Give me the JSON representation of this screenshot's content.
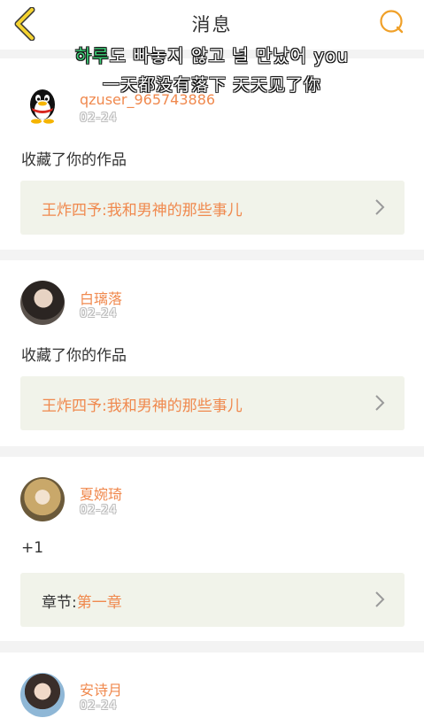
{
  "header": {
    "title": "消息",
    "colors": {
      "accent": "#f0a028",
      "back_fill": "#f5d330"
    }
  },
  "overlay": {
    "line1_accent": "하루",
    "line1_rest": "도 빠놓지 않고 널 만났어 you",
    "line2": "一天都没有落下 天天见了你"
  },
  "messages": [
    {
      "user": "qzuser_965743886",
      "date": "02-24",
      "action": "收藏了你的作品",
      "work_prefix": "",
      "work_title": "王炸四予:我和男神的那些事儿",
      "avatar": "qq-penguin-avatar"
    },
    {
      "user": "白璃落",
      "date": "02-24",
      "action": "收藏了你的作品",
      "work_prefix": "",
      "work_title": "王炸四予:我和男神的那些事儿",
      "avatar": "girl-photo-avatar"
    },
    {
      "user": "夏婉琦",
      "date": "02-24",
      "action": "+1",
      "work_prefix": "章节:",
      "work_title": "第一章",
      "avatar": "doll-photo-avatar"
    },
    {
      "user": "安诗月",
      "date": "02-24",
      "action": "",
      "work_prefix": "",
      "work_title": "",
      "avatar": "girl-selfie-avatar"
    }
  ]
}
